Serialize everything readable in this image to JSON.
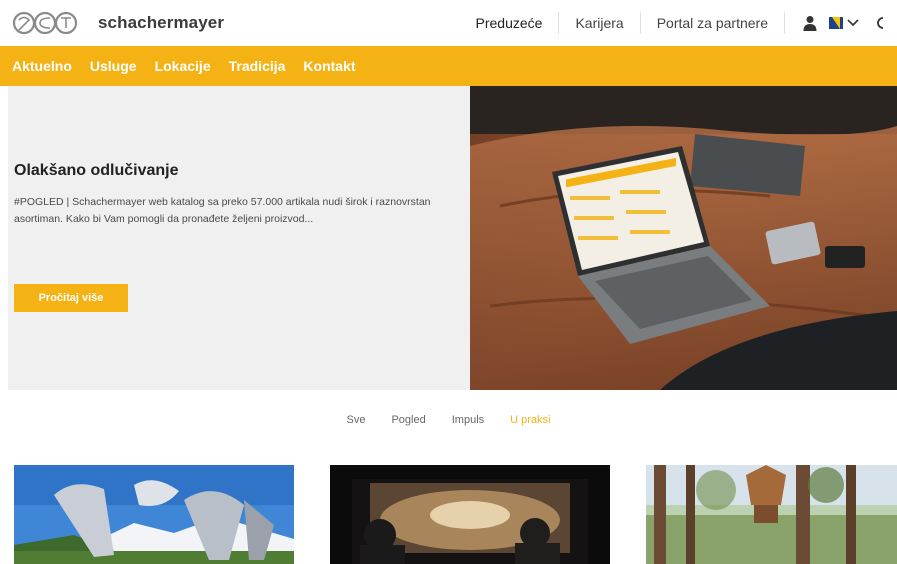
{
  "header": {
    "logo_text": "schachermayer",
    "nav": [
      {
        "label": "Preduzeće"
      },
      {
        "label": "Karijera"
      },
      {
        "label": "Portal za partnere"
      }
    ],
    "icons": {
      "user": "user-icon",
      "flag": "flag-icon",
      "chevron": "chevron-down-icon"
    }
  },
  "subnav": {
    "items": [
      {
        "label": "Aktuelno"
      },
      {
        "label": "Usluge"
      },
      {
        "label": "Lokacije"
      },
      {
        "label": "Tradicija"
      },
      {
        "label": "Kontakt"
      }
    ]
  },
  "hero": {
    "title": "Olakšano odlučivanje",
    "description": "#POGLED | Schachermayer web katalog sa preko 57.000 artikala nudi širok i raznovrstan asortiman. Kako bi Vam pomogli da pronađete željeni proizvod...",
    "button_label": "Pročitaj više"
  },
  "filters": {
    "items": [
      {
        "label": "Sve"
      },
      {
        "label": "Pogled"
      },
      {
        "label": "Impuls"
      },
      {
        "label": "U praksi"
      }
    ],
    "active": "U praksi"
  },
  "colors": {
    "accent": "#f5b214",
    "hero_bg": "#f0f0f0"
  }
}
